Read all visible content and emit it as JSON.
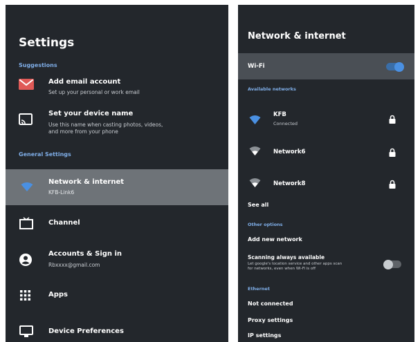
{
  "left": {
    "title": "Settings",
    "suggestions_header": "Suggestions",
    "suggestions": [
      {
        "title": "Add email account",
        "subtitle": "Set up your personal or work email",
        "icon": "email-icon"
      },
      {
        "title": "Set your device name",
        "subtitle_lines": [
          "Use this name when casting photos, videos,",
          "and more from your phone"
        ],
        "icon": "cast-icon"
      }
    ],
    "general_header": "General Settings",
    "general": [
      {
        "title": "Network & internet",
        "subtitle": "KFB-Link6",
        "icon": "wifi-icon",
        "selected": true
      },
      {
        "title": "Channel",
        "subtitle": "",
        "icon": "tv-icon"
      },
      {
        "title": "Accounts & Sign in",
        "subtitle": "Rbxxxx@gmail.com",
        "icon": "account-icon"
      },
      {
        "title": "Apps",
        "subtitle": "",
        "icon": "apps-grid-icon"
      },
      {
        "title": "Device Preferences",
        "subtitle": "",
        "icon": "monitor-icon"
      }
    ]
  },
  "right": {
    "title": "Network & internet",
    "wifi_label": "Wi-Fi",
    "wifi_on": true,
    "available_header": "Available networks",
    "networks": [
      {
        "name": "KFB",
        "status": "Connected",
        "locked": true
      },
      {
        "name": "Network6",
        "status": "",
        "locked": true
      },
      {
        "name": "Network8",
        "status": "",
        "locked": true
      }
    ],
    "see_all": "See all",
    "other_header": "Other options",
    "add_network": "Add new network",
    "scanning_label": "Scanning always available",
    "scanning_desc_lines": [
      "Let google's location service and other apps scan",
      "for networks, even when Wi-Fi is off"
    ],
    "scanning_on": false,
    "ethernet_header": "Ethernet",
    "ethernet_status": "Not connected",
    "proxy": "Proxy settings",
    "ip": "IP settings"
  },
  "colors": {
    "accent": "#4a90e2",
    "section_text": "#7faee8",
    "panel_bg": "#23272c",
    "highlight": "#6e7378"
  }
}
